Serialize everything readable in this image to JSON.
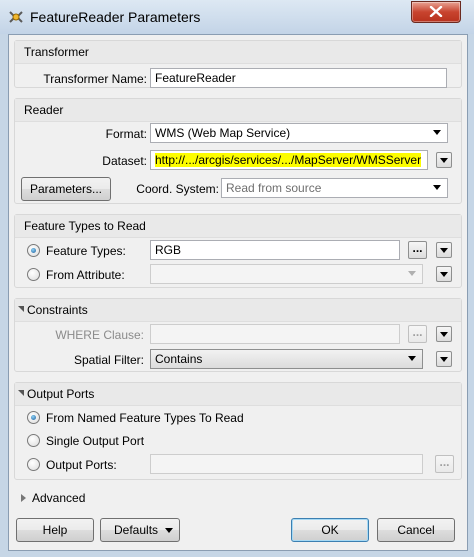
{
  "window": {
    "title": "FeatureReader Parameters"
  },
  "transformer": {
    "section_title": "Transformer",
    "name_label": "Transformer Name:",
    "name_value": "FeatureReader"
  },
  "reader": {
    "section_title": "Reader",
    "format_label": "Format:",
    "format_value": "WMS (Web Map Service)",
    "dataset_label": "Dataset:",
    "dataset_value": "http://.../arcgis/services/.../MapServer/WMSServer",
    "parameters_button": "Parameters...",
    "coord_label": "Coord. System:",
    "coord_value": "Read from source"
  },
  "feature_types": {
    "section_title": "Feature Types to Read",
    "feature_types_label": "Feature Types:",
    "feature_types_value": "RGB",
    "from_attribute_label": "From Attribute:",
    "ellipsis": "..."
  },
  "constraints": {
    "section_title": "Constraints",
    "where_label": "WHERE Clause:",
    "spatial_label": "Spatial Filter:",
    "spatial_value": "Contains",
    "ellipsis": "..."
  },
  "output_ports": {
    "section_title": "Output Ports",
    "option_named": "From Named Feature Types To Read",
    "option_single": "Single Output Port",
    "option_ports": "Output Ports:",
    "ellipsis": "..."
  },
  "advanced": {
    "label": "Advanced"
  },
  "footer": {
    "help_label": "Help",
    "defaults_label": "Defaults",
    "ok_label": "OK",
    "cancel_label": "Cancel"
  },
  "colors": {
    "title_bar": "#c3d4e7",
    "dialog_bg": "#f0f0f0",
    "close_button": "#c8442f",
    "dataset_highlight": "#fdfd00",
    "radio_checked": "#1b5c9d"
  },
  "icons": [
    "app-icon",
    "close-icon",
    "dropdown-arrow-icon",
    "collapse-triangle-icon",
    "expand-triangle-icon"
  ]
}
